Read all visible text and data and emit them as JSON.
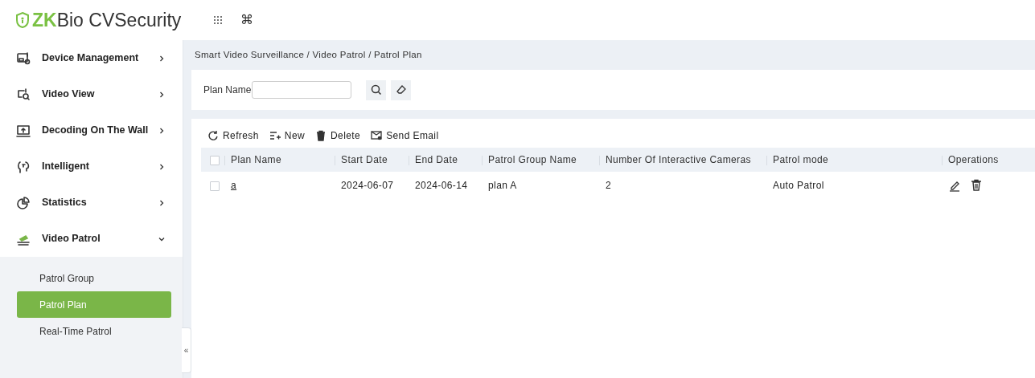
{
  "header": {
    "logo_prefix": "ZK",
    "logo_rest": "Bio CVSecurity",
    "shortcut_glyph": "⌘"
  },
  "sidebar": {
    "items": [
      {
        "label": "Device Management",
        "kind": "device",
        "expanded": false
      },
      {
        "label": "Video View",
        "kind": "view",
        "expanded": false
      },
      {
        "label": "Decoding On The Wall",
        "kind": "wall",
        "expanded": false
      },
      {
        "label": "Intelligent",
        "kind": "intelligent",
        "expanded": false
      },
      {
        "label": "Statistics",
        "kind": "stats",
        "expanded": false
      },
      {
        "label": "Video Patrol",
        "kind": "patrol",
        "expanded": true,
        "children": [
          {
            "label": "Patrol Group",
            "selected": false
          },
          {
            "label": "Patrol Plan",
            "selected": true
          },
          {
            "label": "Real-Time Patrol",
            "selected": false
          }
        ]
      }
    ],
    "collapse_glyph": "«"
  },
  "breadcrumb": "Smart Video Surveillance / Video Patrol / Patrol Plan",
  "search": {
    "label": "Plan Name"
  },
  "toolbar": [
    {
      "label": "Refresh",
      "kind": "refresh"
    },
    {
      "label": "New",
      "kind": "new"
    },
    {
      "label": "Delete",
      "kind": "delete"
    },
    {
      "label": "Send Email",
      "kind": "email"
    }
  ],
  "table": {
    "all_checked": false,
    "columns": [
      "Plan Name",
      "Start Date",
      "End Date",
      "Patrol Group Name",
      "Number Of Interactive Cameras",
      "Patrol mode",
      "Operations"
    ],
    "rows": [
      {
        "checked": false,
        "cells": [
          "a",
          "2024-06-07",
          "2024-06-14",
          "plan A",
          "2",
          "Auto Patrol"
        ]
      }
    ]
  }
}
